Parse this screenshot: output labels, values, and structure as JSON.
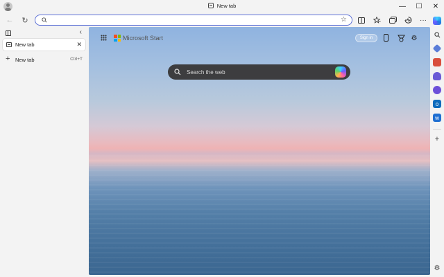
{
  "window": {
    "title": "New tab",
    "minimize": "—",
    "maximize": "☐",
    "close": "✕"
  },
  "toolbar": {
    "back": "←",
    "refresh": "↻",
    "address_value": "",
    "address_placeholder": "",
    "favorite": "☆"
  },
  "tabs": {
    "items": [
      {
        "label": "New tab"
      }
    ],
    "new_tab_label": "New tab",
    "new_tab_shortcut": "Ctrl+T"
  },
  "page": {
    "brand": "Microsoft Start",
    "sign_in": "Sign in",
    "search_placeholder": "Search the web"
  },
  "sidebar": {
    "items": [
      {
        "icon": "copilot-icon",
        "color": "#1f7ae0"
      },
      {
        "icon": "search-icon",
        "color": "#555555"
      },
      {
        "icon": "tag-icon",
        "color": "#5a7dd8"
      },
      {
        "icon": "toolbox-icon",
        "color": "#d94f3d"
      },
      {
        "icon": "games-icon",
        "color": "#6b5bd6"
      },
      {
        "icon": "office-icon",
        "color": "#6c4fd9"
      },
      {
        "icon": "outlook-icon",
        "color": "#0f6cbd"
      },
      {
        "icon": "designer-icon",
        "color": "#1f6fd1"
      }
    ],
    "add": "+",
    "settings": "⚙"
  }
}
